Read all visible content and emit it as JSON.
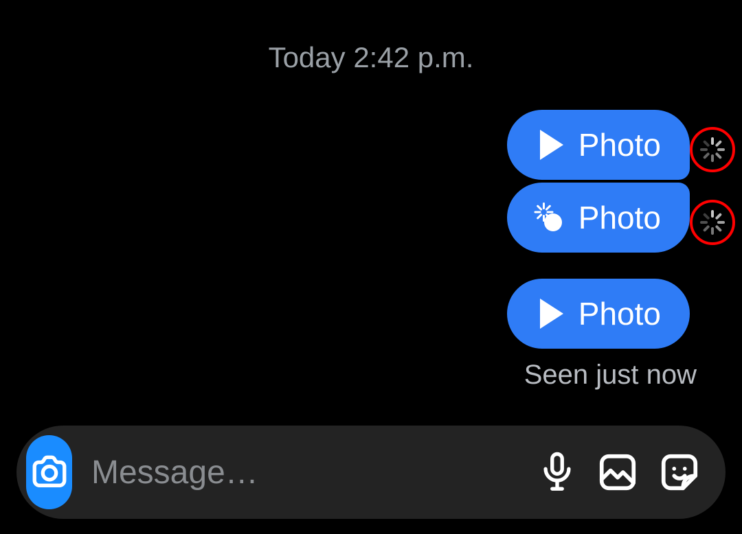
{
  "timestamp": "Today 2:42 p.m.",
  "messages": [
    {
      "label": "Photo",
      "icon": "play",
      "shape": "first",
      "pending": true
    },
    {
      "label": "Photo",
      "icon": "boom",
      "shape": "mid",
      "pending": true
    },
    {
      "label": "Photo",
      "icon": "play",
      "shape": "solo",
      "pending": false
    }
  ],
  "status": "Seen just now",
  "composer": {
    "placeholder": "Message…"
  },
  "colors": {
    "bubble": "#2f7cf6",
    "camera": "#1a8cff",
    "annotation": "#ff0000",
    "composer_bg": "#232323"
  },
  "icons": {
    "camera": "camera-icon",
    "mic": "microphone-icon",
    "gallery": "gallery-icon",
    "sticker": "sticker-icon",
    "play": "play-icon",
    "boom": "disappearing-photo-icon",
    "spinner": "loading-spinner-icon"
  }
}
